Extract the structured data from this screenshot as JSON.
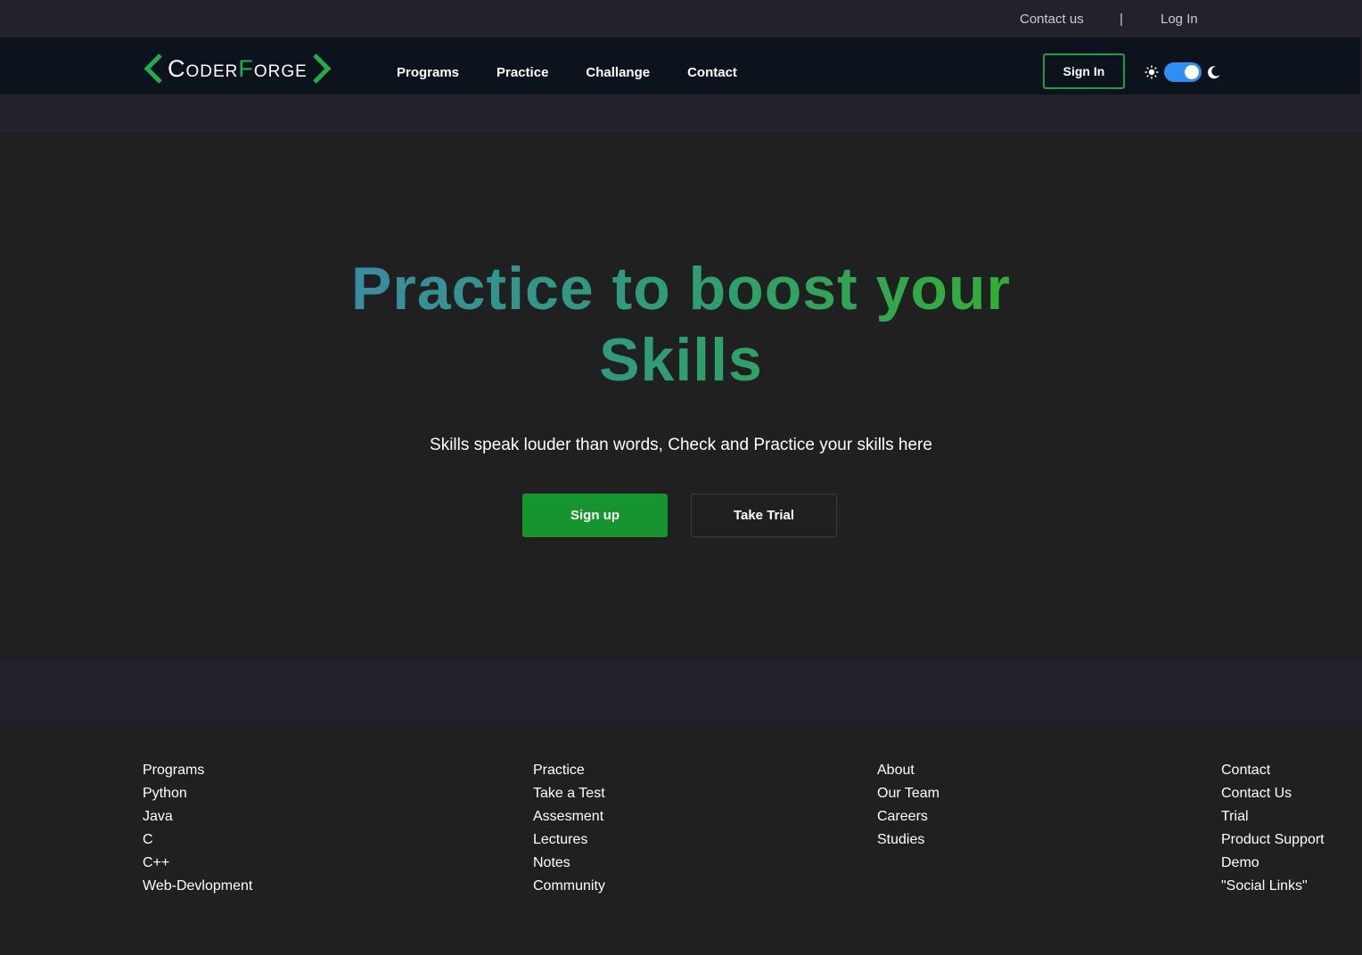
{
  "topbar": {
    "contact_us": "Contact us",
    "separator": "|",
    "log_in": "Log In"
  },
  "brand": {
    "name_part1": "Coder",
    "name_part2": "F",
    "name_part3": "orge",
    "accent_color": "#1fae4a"
  },
  "nav": {
    "items": [
      {
        "label": "Programs"
      },
      {
        "label": "Practice"
      },
      {
        "label": "Challange"
      },
      {
        "label": "Contact"
      }
    ],
    "sign_in": "Sign In",
    "theme_toggle": {
      "state": "on",
      "light_icon": "sun-icon",
      "dark_icon": "moon-icon",
      "color": "#2f8ef3"
    }
  },
  "hero": {
    "title_line1": "Practice to boost your",
    "title_line2": "Skills",
    "subtitle": "Skills speak louder than words, Check and Practice your skills here",
    "signup_label": "Sign up",
    "trial_label": "Take Trial",
    "primary_color": "#16942e"
  },
  "footer": {
    "columns": [
      {
        "heading": "Programs",
        "links": [
          "Python",
          "Java",
          "C",
          "C++",
          "Web-Devlopment"
        ]
      },
      {
        "heading": "Practice",
        "links": [
          "Take a Test",
          "Assesment",
          "Lectures",
          "Notes",
          "Community"
        ]
      },
      {
        "heading": "About",
        "links": [
          "Our Team",
          "Careers",
          "Studies"
        ]
      },
      {
        "heading": "Contact",
        "links": [
          "Contact Us",
          "Trial",
          "Product Support",
          "Demo",
          "\"Social Links\""
        ]
      }
    ]
  }
}
